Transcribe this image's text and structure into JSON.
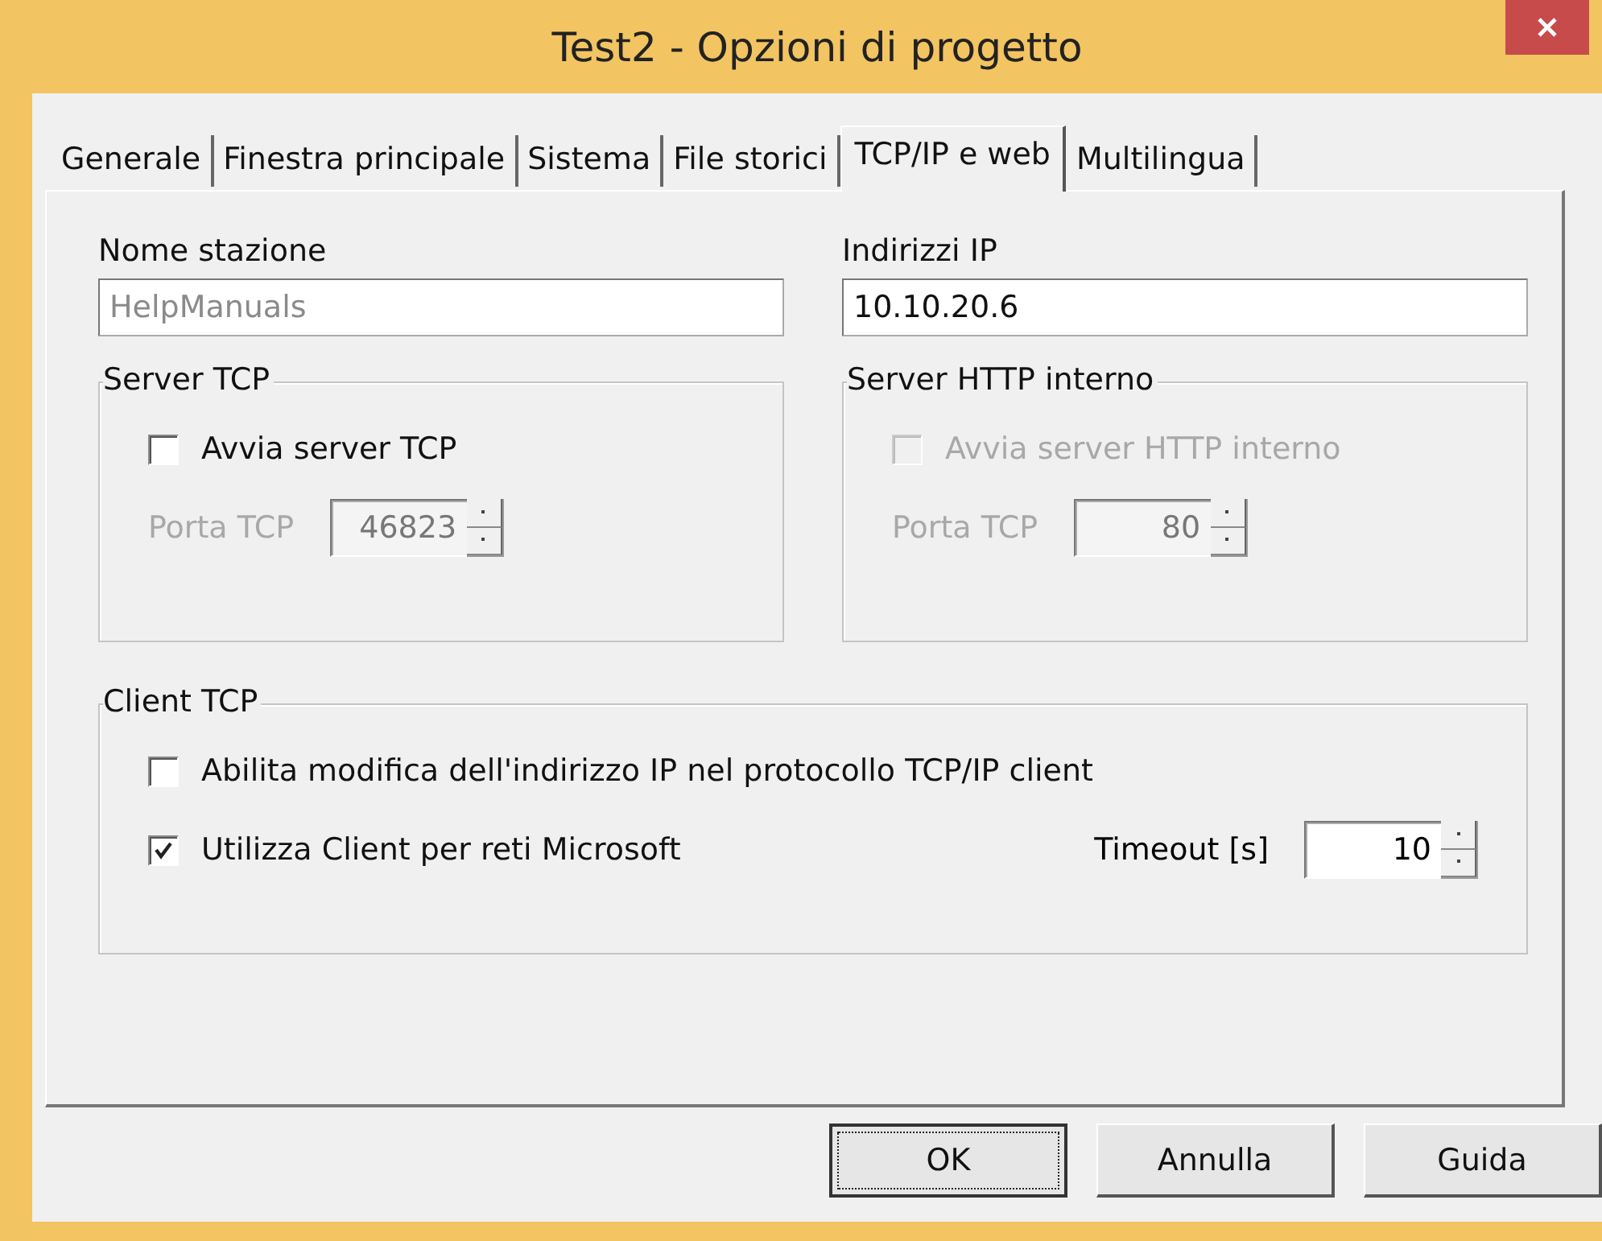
{
  "window": {
    "title": "Test2 - Opzioni di progetto"
  },
  "tabs": [
    {
      "label": "Generale",
      "selected": false
    },
    {
      "label": "Finestra principale",
      "selected": false
    },
    {
      "label": "Sistema",
      "selected": false
    },
    {
      "label": "File storici",
      "selected": false
    },
    {
      "label": "TCP/IP e web",
      "selected": true
    },
    {
      "label": "Multilingua",
      "selected": false
    }
  ],
  "fields": [
    {
      "label": "Nome stazione",
      "value": "HelpManuals",
      "disabled": true
    },
    {
      "label": "Indirizzi IP",
      "value": "10.10.20.6",
      "disabled": false
    }
  ],
  "groups": [
    {
      "title": "Server TCP",
      "checkbox": {
        "label": "Avvia server TCP",
        "checked": false,
        "disabled": false
      },
      "port": {
        "label": "Porta TCP",
        "value": "46823",
        "disabled": true
      }
    },
    {
      "title": "Server HTTP interno",
      "checkbox": {
        "label": "Avvia server HTTP interno",
        "checked": false,
        "disabled": true
      },
      "port": {
        "label": "Porta TCP",
        "value": "80",
        "disabled": true
      }
    }
  ],
  "client": {
    "title": "Client TCP",
    "checkboxes": [
      {
        "label": "Abilita modifica dell'indirizzo IP nel protocollo TCP/IP client",
        "checked": false,
        "disabled": false
      },
      {
        "label": "Utilizza Client per reti Microsoft",
        "checked": true,
        "disabled": false
      }
    ],
    "timeout": {
      "label": "Timeout [s]",
      "value": "10",
      "disabled": false
    }
  },
  "buttons": [
    {
      "label": "OK",
      "default": true
    },
    {
      "label": "Annulla",
      "default": false
    },
    {
      "label": "Guida",
      "default": false
    }
  ]
}
